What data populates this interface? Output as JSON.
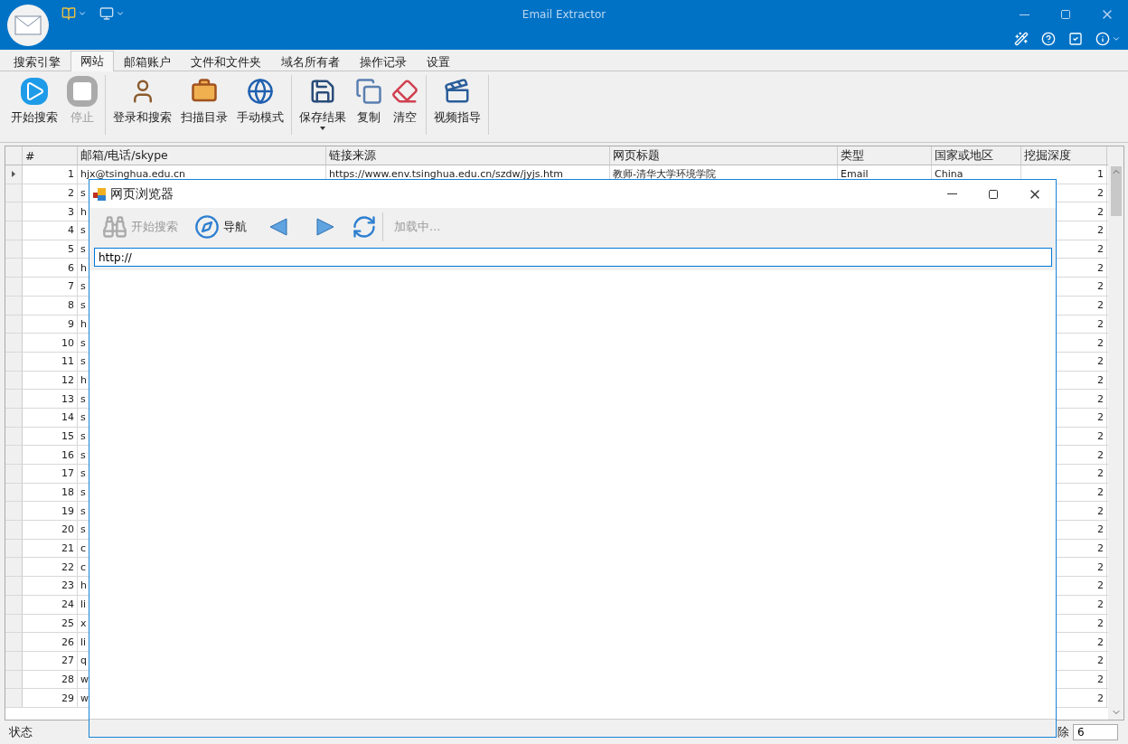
{
  "window": {
    "title": "Email Extractor"
  },
  "quick_access": [
    {
      "kind": "book"
    },
    {
      "kind": "monitor"
    }
  ],
  "header_icons": [
    {
      "kind": "wand"
    },
    {
      "kind": "help"
    },
    {
      "kind": "check"
    },
    {
      "kind": "info"
    }
  ],
  "tabs": [
    {
      "label": "搜索引擎",
      "selected": false
    },
    {
      "label": "网站",
      "selected": true
    },
    {
      "label": "邮箱账户",
      "selected": false
    },
    {
      "label": "文件和文件夹",
      "selected": false
    },
    {
      "label": "域名所有者",
      "selected": false
    },
    {
      "label": "操作记录",
      "selected": false
    },
    {
      "label": "设置",
      "selected": false
    }
  ],
  "ribbon_groups": [
    [
      {
        "label": "开始搜索",
        "kind": "play",
        "disabled": false,
        "dropdown": false
      },
      {
        "label": "停止",
        "kind": "stop",
        "disabled": true,
        "dropdown": false
      }
    ],
    [
      {
        "label": "登录和搜索",
        "kind": "user",
        "disabled": false,
        "dropdown": false
      },
      {
        "label": "扫描目录",
        "kind": "briefcase",
        "disabled": false,
        "dropdown": false
      },
      {
        "label": "手动模式",
        "kind": "globe",
        "disabled": false,
        "dropdown": false
      }
    ],
    [
      {
        "label": "保存结果",
        "kind": "save",
        "disabled": false,
        "dropdown": true
      },
      {
        "label": "复制",
        "kind": "copy",
        "disabled": false,
        "dropdown": false
      },
      {
        "label": "清空",
        "kind": "eraser",
        "disabled": false,
        "dropdown": false
      }
    ],
    [
      {
        "label": "视频指导",
        "kind": "video",
        "disabled": false,
        "dropdown": false
      }
    ]
  ],
  "table": {
    "columns": [
      "#",
      "邮箱/电话/skype",
      "链接来源",
      "网页标题",
      "类型",
      "国家或地区",
      "挖掘深度"
    ],
    "rows": [
      {
        "selected": true,
        "cells": [
          "1",
          "hjx@tsinghua.edu.cn",
          "https://www.env.tsinghua.edu.cn/szdw/jyjs.htm",
          "教师-清华大学环境学院",
          "Email",
          "China",
          "1"
        ]
      },
      {
        "selected": false,
        "cells": [
          "2",
          "s",
          "",
          "",
          "",
          "",
          "2"
        ]
      },
      {
        "selected": false,
        "cells": [
          "3",
          "h",
          "",
          "",
          "",
          "",
          "2"
        ]
      },
      {
        "selected": false,
        "cells": [
          "4",
          "s",
          "",
          "",
          "",
          "",
          "2"
        ]
      },
      {
        "selected": false,
        "cells": [
          "5",
          "s",
          "",
          "",
          "",
          "",
          "2"
        ]
      },
      {
        "selected": false,
        "cells": [
          "6",
          "h",
          "",
          "",
          "",
          "",
          "2"
        ]
      },
      {
        "selected": false,
        "cells": [
          "7",
          "s",
          "",
          "",
          "",
          "",
          "2"
        ]
      },
      {
        "selected": false,
        "cells": [
          "8",
          "s",
          "",
          "",
          "",
          "",
          "2"
        ]
      },
      {
        "selected": false,
        "cells": [
          "9",
          "h",
          "",
          "",
          "",
          "",
          "2"
        ]
      },
      {
        "selected": false,
        "cells": [
          "10",
          "s",
          "",
          "",
          "",
          "",
          "2"
        ]
      },
      {
        "selected": false,
        "cells": [
          "11",
          "s",
          "",
          "",
          "",
          "",
          "2"
        ]
      },
      {
        "selected": false,
        "cells": [
          "12",
          "h",
          "",
          "",
          "",
          "",
          "2"
        ]
      },
      {
        "selected": false,
        "cells": [
          "13",
          "s",
          "",
          "",
          "",
          "",
          "2"
        ]
      },
      {
        "selected": false,
        "cells": [
          "14",
          "s",
          "",
          "",
          "",
          "",
          "2"
        ]
      },
      {
        "selected": false,
        "cells": [
          "15",
          "s",
          "",
          "",
          "",
          "",
          "2"
        ]
      },
      {
        "selected": false,
        "cells": [
          "16",
          "s",
          "",
          "",
          "",
          "",
          "2"
        ]
      },
      {
        "selected": false,
        "cells": [
          "17",
          "s",
          "",
          "",
          "",
          "",
          "2"
        ]
      },
      {
        "selected": false,
        "cells": [
          "18",
          "s",
          "",
          "",
          "",
          "",
          "2"
        ]
      },
      {
        "selected": false,
        "cells": [
          "19",
          "s",
          "",
          "",
          "",
          "",
          "2"
        ]
      },
      {
        "selected": false,
        "cells": [
          "20",
          "s",
          "",
          "",
          "",
          "",
          "2"
        ]
      },
      {
        "selected": false,
        "cells": [
          "21",
          "c",
          "",
          "",
          "",
          "",
          "2"
        ]
      },
      {
        "selected": false,
        "cells": [
          "22",
          "c",
          "",
          "",
          "",
          "",
          "2"
        ]
      },
      {
        "selected": false,
        "cells": [
          "23",
          "h",
          "",
          "",
          "",
          "",
          "2"
        ]
      },
      {
        "selected": false,
        "cells": [
          "24",
          "li",
          "",
          "",
          "",
          "",
          "2"
        ]
      },
      {
        "selected": false,
        "cells": [
          "25",
          "x",
          "",
          "",
          "",
          "",
          "2"
        ]
      },
      {
        "selected": false,
        "cells": [
          "26",
          "li",
          "",
          "",
          "",
          "",
          "2"
        ]
      },
      {
        "selected": false,
        "cells": [
          "27",
          "q",
          "",
          "",
          "",
          "",
          "2"
        ]
      },
      {
        "selected": false,
        "cells": [
          "28",
          "w",
          "",
          "",
          "",
          "",
          "2"
        ]
      },
      {
        "selected": false,
        "cells": [
          "29",
          "w",
          "",
          "",
          "",
          "",
          "2"
        ]
      }
    ]
  },
  "status_bar": {
    "label": "状态",
    "field_label": "除",
    "field_value": "6"
  },
  "browser_dialog": {
    "title": "网页浏览器",
    "toolbar": [
      {
        "kind": "binoculars",
        "label": "开始搜索",
        "disabled": true
      },
      {
        "kind": "compass",
        "label": "导航",
        "disabled": false
      },
      {
        "kind": "back",
        "disabled": false
      },
      {
        "kind": "forward",
        "disabled": false
      },
      {
        "kind": "refresh",
        "disabled": false
      },
      {
        "kind": "separator"
      },
      {
        "kind": "text",
        "label": "加载中...",
        "disabled": true
      }
    ],
    "url": "http://"
  }
}
